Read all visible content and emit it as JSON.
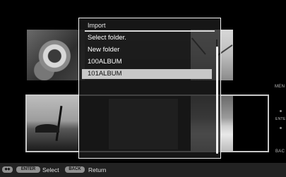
{
  "dialog": {
    "title": "Import",
    "subtitle": "Select folder.",
    "items": [
      {
        "label": "New folder",
        "selected": false
      },
      {
        "label": "100ALBUM",
        "selected": false
      },
      {
        "label": "101ALBUM",
        "selected": true
      }
    ]
  },
  "side": {
    "menu_label": "MEN",
    "enter_label": "ENTE",
    "back_label": "BAC"
  },
  "footer": {
    "arrows_key": "◆◆",
    "enter_key": "ENTER",
    "select_label": "Select",
    "back_key": "BACK",
    "return_label": "Return"
  }
}
